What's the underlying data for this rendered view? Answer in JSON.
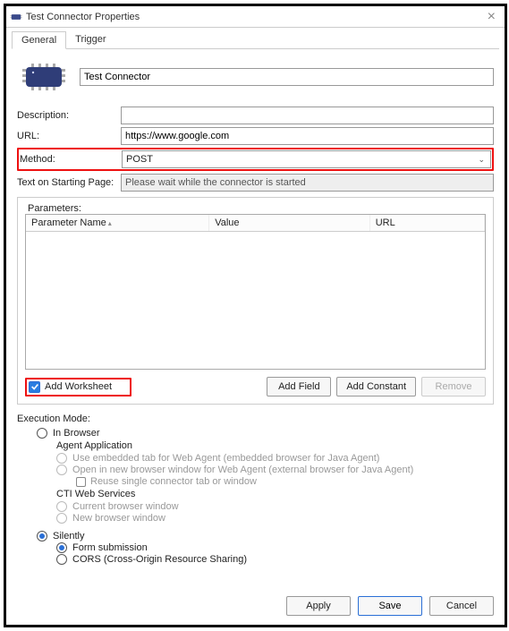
{
  "window": {
    "title": "Test Connector Properties",
    "close": "×"
  },
  "tabs": {
    "general": "General",
    "trigger": "Trigger"
  },
  "header": {
    "name_value": "Test Connector"
  },
  "form": {
    "description_label": "Description:",
    "description_value": "",
    "url_label": "URL:",
    "url_value": "https://www.google.com",
    "method_label": "Method:",
    "method_value": "POST",
    "starttext_label": "Text on Starting Page:",
    "starttext_value": "Please wait while the connector is started"
  },
  "parameters": {
    "title": "Parameters:",
    "col_name": "Parameter Name",
    "col_value": "Value",
    "col_url": "URL",
    "add_worksheet": "Add Worksheet",
    "btn_addfield": "Add Field",
    "btn_addconst": "Add Constant",
    "btn_remove": "Remove"
  },
  "exec": {
    "title": "Execution Mode:",
    "in_browser": "In Browser",
    "agent_app": "Agent Application",
    "embedded": "Use embedded tab for Web Agent (embedded browser for Java Agent)",
    "newwin": "Open in new browser window for Web Agent (external browser for Java Agent)",
    "reuse": "Reuse single connector tab or window",
    "ctiws": "CTI Web Services",
    "cti_current": "Current browser window",
    "cti_new": "New browser window",
    "silently": "Silently",
    "form_sub": "Form submission",
    "cors": "CORS (Cross-Origin Resource Sharing)"
  },
  "footer": {
    "apply": "Apply",
    "save": "Save",
    "cancel": "Cancel"
  }
}
